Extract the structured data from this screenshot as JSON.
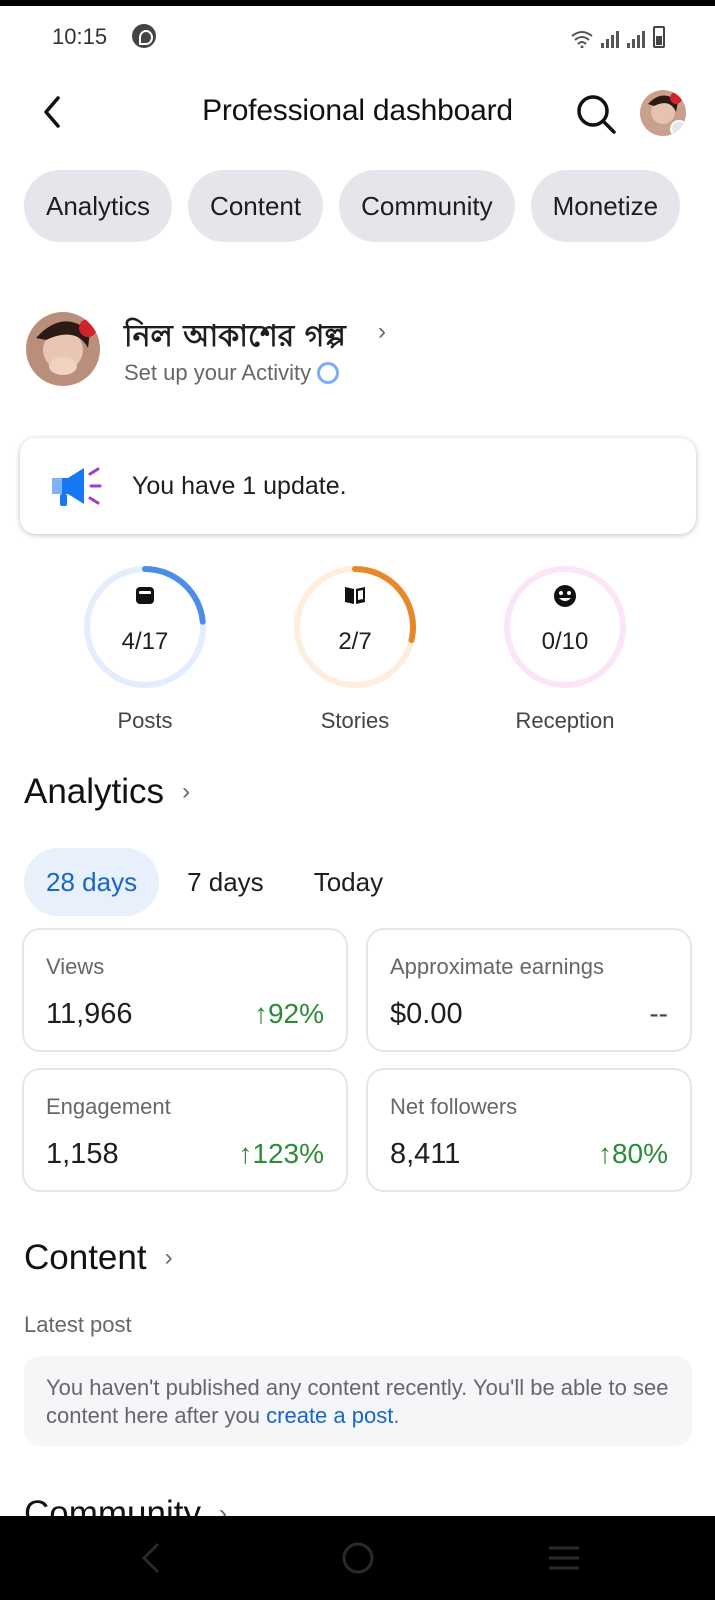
{
  "status_bar": {
    "time": "10:15"
  },
  "header": {
    "title": "Professional dashboard"
  },
  "tabs": [
    {
      "label": "Analytics"
    },
    {
      "label": "Content"
    },
    {
      "label": "Community"
    },
    {
      "label": "Monetize"
    }
  ],
  "profile": {
    "name": "নিল আকাশের গল্প",
    "subtitle": "Set up your Activity"
  },
  "update": {
    "text": "You have 1 update."
  },
  "goals": [
    {
      "label": "Posts",
      "value": "4/17",
      "progress": 0.235,
      "color": "#4a8fe7",
      "track": "#e3eefc",
      "icon": "calendar-icon"
    },
    {
      "label": "Stories",
      "value": "2/7",
      "progress": 0.286,
      "color": "#e6892b",
      "track": "#fdeedd",
      "icon": "book-icon"
    },
    {
      "label": "Reception",
      "value": "0/10",
      "progress": 0,
      "color": "#e05fc8",
      "track": "#fbe6f7",
      "icon": "smiley-icon"
    }
  ],
  "analytics": {
    "heading": "Analytics",
    "ranges": [
      {
        "label": "28 days",
        "active": true
      },
      {
        "label": "7 days",
        "active": false
      },
      {
        "label": "Today",
        "active": false
      }
    ],
    "cards": [
      {
        "label": "Views",
        "value": "11,966",
        "delta": "↑92%"
      },
      {
        "label": "Approximate earnings",
        "value": "$0.00",
        "delta": "--"
      },
      {
        "label": "Engagement",
        "value": "1,158",
        "delta": "↑123%"
      },
      {
        "label": "Net followers",
        "value": "8,411",
        "delta": "↑80%"
      }
    ]
  },
  "content": {
    "heading": "Content",
    "sub": "Latest post",
    "empty_text": "You haven't published any content recently. You'll be able to see content here after you ",
    "empty_link": "create a post",
    "empty_end": "."
  },
  "community": {
    "heading": "Community"
  },
  "colors": {
    "accent": "#1866c6",
    "positive": "#2e8b3a",
    "pill": "#e4e6eb"
  }
}
